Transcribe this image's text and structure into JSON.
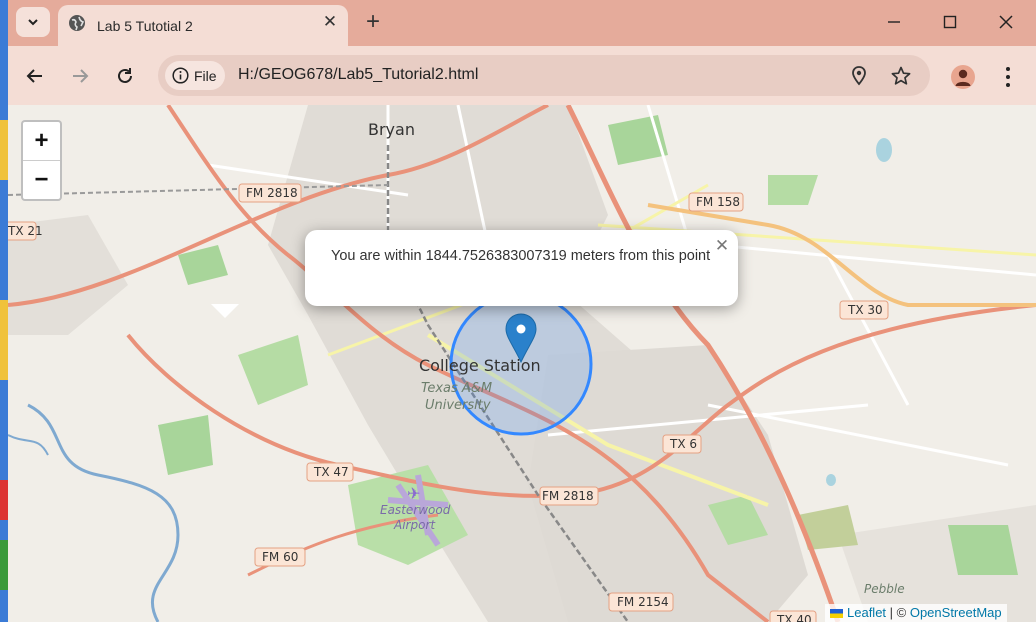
{
  "browser": {
    "tab_title": "Lab 5 Tutotial 2",
    "address_chip": "File",
    "url": "H:/GEOG678/Lab5_Tutorial2.html"
  },
  "map": {
    "popup_text": "You are within 1844.7526383007319 meters from this point",
    "city_label": "College Station",
    "university_label": "Texas A&M University",
    "airport_label": "Easterwood Airport",
    "bryan_label": "Bryan",
    "pebble_label": "Pebble",
    "road_labels": {
      "fm2818_top": "FM 2818",
      "fm158": "FM 158",
      "tx21": "TX 21",
      "tx30": "TX 30",
      "tx6": "TX 6",
      "tx47": "TX 47",
      "fm2818_bottom": "FM 2818",
      "fm60": "FM 60",
      "fm2154": "FM 2154",
      "tx40": "TX 40"
    },
    "zoom_in": "+",
    "zoom_out": "−",
    "attribution": {
      "leaflet": "Leaflet",
      "separator": " | © ",
      "osm": "OpenStreetMap"
    }
  },
  "colors": {
    "titlebar": "#e5ab9b",
    "toolbar": "#f4ddd5",
    "marker": "#2a81cb",
    "circle": "#3388ff"
  }
}
